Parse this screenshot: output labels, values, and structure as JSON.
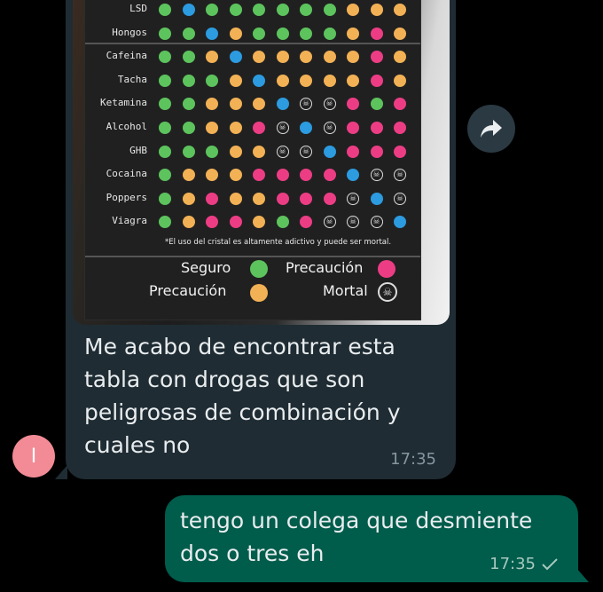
{
  "colors": {
    "green": "#5dc35d",
    "blue": "#2c9be0",
    "orange": "#f2b155",
    "pink": "#ec3d84",
    "skull": "skull"
  },
  "chart": {
    "rows": [
      {
        "label": "LSD",
        "dots": [
          "green",
          "blue",
          "green",
          "green",
          "green",
          "green",
          "green",
          "green",
          "orange",
          "orange",
          "orange"
        ]
      },
      {
        "label": "Hongos",
        "dots": [
          "green",
          "green",
          "blue",
          "orange",
          "green",
          "green",
          "green",
          "green",
          "orange",
          "pink",
          "orange"
        ]
      },
      {
        "label": "Cafeina",
        "dots": [
          "green",
          "green",
          "orange",
          "blue",
          "orange",
          "orange",
          "orange",
          "orange",
          "orange",
          "pink",
          "orange"
        ]
      },
      {
        "label": "Tacha",
        "dots": [
          "green",
          "green",
          "green",
          "orange",
          "blue",
          "orange",
          "orange",
          "orange",
          "orange",
          "pink",
          "orange"
        ]
      },
      {
        "label": "Ketamina",
        "dots": [
          "green",
          "green",
          "orange",
          "orange",
          "orange",
          "blue",
          "skull",
          "skull",
          "pink",
          "green",
          "pink"
        ]
      },
      {
        "label": "Alcohol",
        "dots": [
          "green",
          "green",
          "orange",
          "orange",
          "pink",
          "skull",
          "blue",
          "skull",
          "pink",
          "pink",
          "pink"
        ]
      },
      {
        "label": "GHB",
        "dots": [
          "green",
          "green",
          "green",
          "orange",
          "orange",
          "skull",
          "skull",
          "blue",
          "pink",
          "pink",
          "pink"
        ]
      },
      {
        "label": "Cocaina",
        "dots": [
          "green",
          "orange",
          "orange",
          "orange",
          "pink",
          "pink",
          "pink",
          "pink",
          "blue",
          "skull",
          "skull"
        ]
      },
      {
        "label": "Poppers",
        "dots": [
          "green",
          "orange",
          "pink",
          "orange",
          "orange",
          "pink",
          "pink",
          "pink",
          "skull",
          "blue",
          "skull"
        ]
      },
      {
        "label": "Viagra",
        "dots": [
          "green",
          "orange",
          "pink",
          "pink",
          "orange",
          "green",
          "pink",
          "skull",
          "skull",
          "skull",
          "blue"
        ]
      }
    ],
    "footnote": "*El uso del cristal es altamente adictivo y puede ser mortal.",
    "legend": {
      "seguro": "Seguro",
      "precaucion_pink": "Precaución",
      "precaucion_orange": "Precaución",
      "mortal": "Mortal"
    }
  },
  "incoming": {
    "avatar_letter": "I",
    "lines": [
      "Me acabo de encontrar esta",
      "tabla con drogas que son",
      "peligrosas de combinación y",
      "cuales no"
    ],
    "time": "17:35"
  },
  "outgoing": {
    "lines": [
      "tengo un colega que desmiente",
      "dos o tres eh"
    ],
    "time": "17:35",
    "status_icon": "check-icon"
  },
  "forward_icon": "forward-icon"
}
